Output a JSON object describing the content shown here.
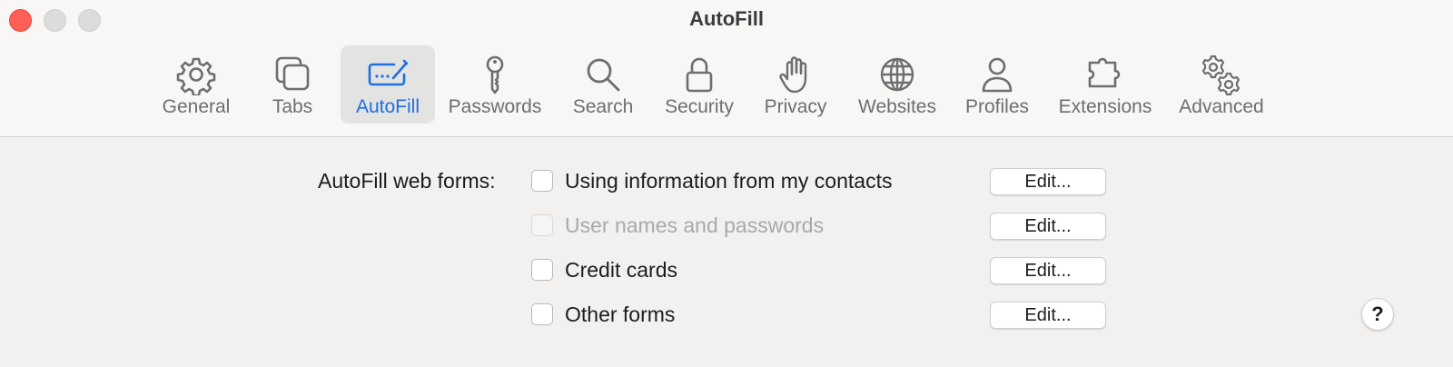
{
  "window": {
    "title": "AutoFill"
  },
  "toolbar": {
    "tabs": [
      {
        "label": "General",
        "icon": "gear-icon",
        "active": false
      },
      {
        "label": "Tabs",
        "icon": "tabs-icon",
        "active": false
      },
      {
        "label": "AutoFill",
        "icon": "autofill-icon",
        "active": true
      },
      {
        "label": "Passwords",
        "icon": "key-icon",
        "active": false
      },
      {
        "label": "Search",
        "icon": "search-icon",
        "active": false
      },
      {
        "label": "Security",
        "icon": "lock-icon",
        "active": false
      },
      {
        "label": "Privacy",
        "icon": "hand-icon",
        "active": false
      },
      {
        "label": "Websites",
        "icon": "globe-icon",
        "active": false
      },
      {
        "label": "Profiles",
        "icon": "person-icon",
        "active": false
      },
      {
        "label": "Extensions",
        "icon": "puzzle-icon",
        "active": false
      },
      {
        "label": "Advanced",
        "icon": "gears-icon",
        "active": false
      }
    ]
  },
  "autofill": {
    "section_label": "AutoFill web forms:",
    "options": [
      {
        "label": "Using information from my contacts",
        "checked": false,
        "enabled": true,
        "button": "Edit..."
      },
      {
        "label": "User names and passwords",
        "checked": false,
        "enabled": false,
        "button": "Edit..."
      },
      {
        "label": "Credit cards",
        "checked": false,
        "enabled": true,
        "button": "Edit..."
      },
      {
        "label": "Other forms",
        "checked": false,
        "enabled": true,
        "button": "Edit..."
      }
    ]
  },
  "help": {
    "label": "?"
  },
  "colors": {
    "accent": "#1f6fe0",
    "close": "#fe5f57",
    "icon": "#6e6e6e"
  }
}
